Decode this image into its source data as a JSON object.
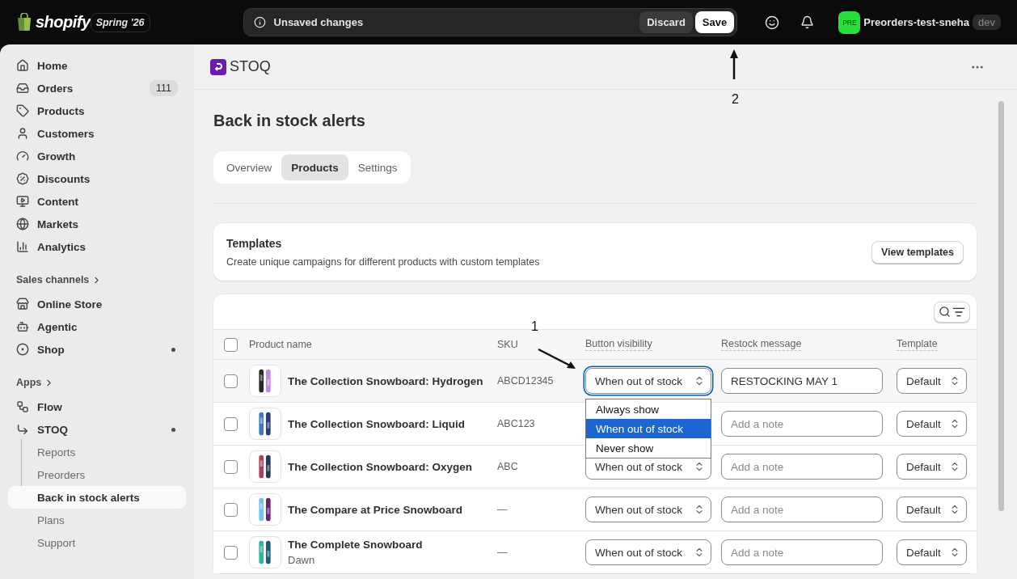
{
  "top_bar": {
    "logo": "shopify",
    "edition": "Spring '26",
    "unsaved": {
      "message": "Unsaved changes",
      "buttons": [
        {
          "label": "Discard",
          "kind": "secondary"
        },
        {
          "label": "Save",
          "kind": "primary"
        }
      ]
    },
    "store": {
      "avatar": "PRE",
      "name": "Preorders-test-sneha",
      "badge": "dev"
    }
  },
  "sidebar": {
    "sections": [
      {
        "items": [
          {
            "label": "Home",
            "selected": false
          },
          {
            "label": "Orders",
            "badge": "111",
            "selected": false
          },
          {
            "label": "Products",
            "selected": false
          },
          {
            "label": "Customers",
            "selected": false
          },
          {
            "label": "Growth",
            "selected": false
          },
          {
            "label": "Discounts",
            "selected": false
          },
          {
            "label": "Content",
            "selected": false
          },
          {
            "label": "Markets",
            "selected": false
          },
          {
            "label": "Analytics",
            "selected": false
          }
        ]
      },
      {
        "heading": "Sales channels",
        "items": [
          {
            "label": "Online Store",
            "selected": false
          },
          {
            "label": "Agentic",
            "selected": false
          },
          {
            "label": "Shop",
            "dot": true,
            "selected": false
          }
        ]
      },
      {
        "heading": "Apps",
        "items": [
          {
            "label": "Flow",
            "selected": false
          },
          {
            "label": "STOQ",
            "dot": true,
            "selected": false,
            "children": [
              {
                "label": "Reports",
                "selected": false
              },
              {
                "label": "Preorders",
                "selected": false
              },
              {
                "label": "Back in stock alerts",
                "selected": true
              },
              {
                "label": "Plans",
                "selected": false
              },
              {
                "label": "Support",
                "selected": false
              }
            ]
          }
        ]
      }
    ]
  },
  "app_header": {
    "title": "STOQ"
  },
  "page": {
    "title": "Back in stock alerts",
    "tabs": [
      {
        "label": "Overview",
        "selected": false
      },
      {
        "label": "Products",
        "selected": true
      },
      {
        "label": "Settings",
        "selected": false
      }
    ],
    "templates_card": {
      "title": "Templates",
      "description": "Create unique campaigns for different products with custom templates",
      "button": "View templates"
    },
    "table": {
      "select_all_checked": false,
      "columns": [
        {
          "label": "Product name",
          "underlined": false
        },
        {
          "label": "SKU",
          "underlined": false
        },
        {
          "label": "Button visibility",
          "underlined": true
        },
        {
          "label": "Restock message",
          "underlined": true
        },
        {
          "label": "Template",
          "underlined": true
        }
      ],
      "rows": [
        {
          "name": "The Collection Snowboard: Hydrogen",
          "sku": "ABCD12345",
          "visibility": "When out of stock",
          "restock_message": "RESTOCKING MAY 1",
          "template": "Default",
          "checked": false,
          "active": true,
          "dropdown": [
            {
              "label": "Always show",
              "selected": false
            },
            {
              "label": "When out of stock",
              "selected": true
            },
            {
              "label": "Never show",
              "selected": false
            }
          ]
        },
        {
          "name": "The Collection Snowboard: Liquid",
          "sku": "ABC123",
          "restock_placeholder": "Add a note",
          "template": "Default",
          "checked": false,
          "active": false
        },
        {
          "name": "The Collection Snowboard: Oxygen",
          "sku": "ABC",
          "visibility": "When out of stock",
          "restock_placeholder": "Add a note",
          "template": "Default",
          "checked": false,
          "active": false
        },
        {
          "name": "The Compare at Price Snowboard",
          "sku": "—",
          "visibility": "When out of stock",
          "restock_placeholder": "Add a note",
          "template": "Default",
          "checked": false,
          "active": false
        },
        {
          "name": "The Complete Snowboard",
          "variant": "Dawn",
          "sku": "—",
          "visibility": "When out of stock",
          "restock_placeholder": "Add a note",
          "template": "Default",
          "checked": false,
          "active": false
        }
      ]
    }
  },
  "annotations": [
    {
      "label": "1"
    },
    {
      "label": "2"
    }
  ]
}
